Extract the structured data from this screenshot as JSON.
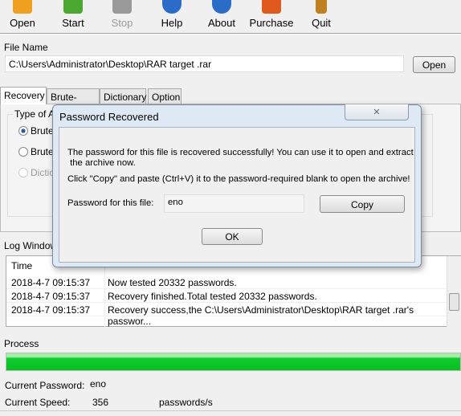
{
  "toolbar": [
    {
      "label": "Open",
      "icon": "open-folder-icon",
      "color": "#f0a020"
    },
    {
      "label": "Start",
      "icon": "play-icon",
      "color": "#4aa830"
    },
    {
      "label": "Stop",
      "icon": "stop-icon",
      "color": "#9a9a9a"
    },
    {
      "label": "Help",
      "icon": "help-icon",
      "color": "#2a6cc8"
    },
    {
      "label": "About",
      "icon": "info-icon",
      "color": "#2a6cc8"
    },
    {
      "label": "Purchase",
      "icon": "cart-icon",
      "color": "#e05a20"
    },
    {
      "label": "Quit",
      "icon": "door-icon",
      "color": "#c08020"
    }
  ],
  "file": {
    "label": "File Name",
    "value": "C:\\Users\\Administrator\\Desktop\\RAR target .rar",
    "open_label": "Open"
  },
  "tabs": [
    "Recovery",
    "Brute-force",
    "Dictionary",
    "Option"
  ],
  "attack": {
    "group_label": "Type of At",
    "options": [
      "Brute",
      "Brute",
      "Diction"
    ]
  },
  "log": {
    "label": "Log Window",
    "col_time": "Time",
    "rows": [
      {
        "time": "2018-4-7 09:15:37",
        "msg": "Now tested  20332 passwords."
      },
      {
        "time": "2018-4-7 09:15:37",
        "msg": "Recovery finished.Total tested  20332 passwords."
      },
      {
        "time": "2018-4-7 09:15:37",
        "msg": "Recovery success,the C:\\Users\\Administrator\\Desktop\\RAR target .rar's passwor..."
      }
    ]
  },
  "process": {
    "label": "Process",
    "progress_percent": 100,
    "current_password_label": "Current Password:",
    "current_password": "eno",
    "speed_label": "Current Speed:",
    "speed": "356",
    "speed_unit": "passwords/s"
  },
  "dialog": {
    "title": "Password Recovered",
    "close": "✕",
    "line1": "The password for this file is recovered successfully! You can use it to open and extract",
    "line2": " the archive now.",
    "line3": "Click \"Copy\" and paste (Ctrl+V) it to the password-required blank to open the archive!",
    "pw_label": "Password for this file:",
    "pw_value": "eno",
    "copy_label": "Copy",
    "ok_label": "OK"
  }
}
